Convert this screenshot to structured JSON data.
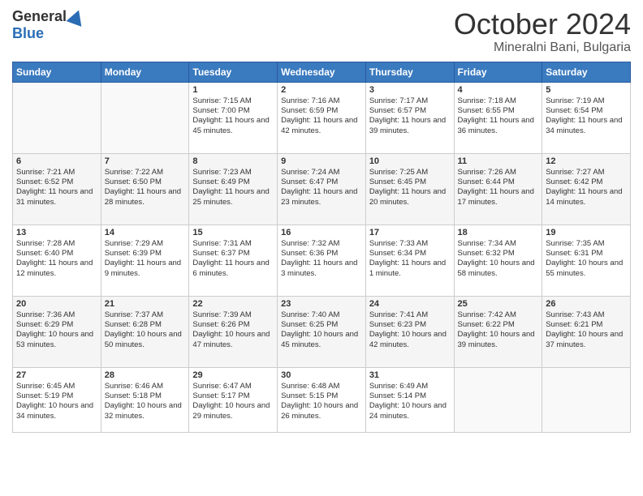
{
  "logo": {
    "general": "General",
    "blue": "Blue"
  },
  "title": "October 2024",
  "location": "Mineralni Bani, Bulgaria",
  "days_header": [
    "Sunday",
    "Monday",
    "Tuesday",
    "Wednesday",
    "Thursday",
    "Friday",
    "Saturday"
  ],
  "weeks": [
    [
      {
        "num": "",
        "text": ""
      },
      {
        "num": "",
        "text": ""
      },
      {
        "num": "1",
        "text": "Sunrise: 7:15 AM\nSunset: 7:00 PM\nDaylight: 11 hours and 45 minutes."
      },
      {
        "num": "2",
        "text": "Sunrise: 7:16 AM\nSunset: 6:59 PM\nDaylight: 11 hours and 42 minutes."
      },
      {
        "num": "3",
        "text": "Sunrise: 7:17 AM\nSunset: 6:57 PM\nDaylight: 11 hours and 39 minutes."
      },
      {
        "num": "4",
        "text": "Sunrise: 7:18 AM\nSunset: 6:55 PM\nDaylight: 11 hours and 36 minutes."
      },
      {
        "num": "5",
        "text": "Sunrise: 7:19 AM\nSunset: 6:54 PM\nDaylight: 11 hours and 34 minutes."
      }
    ],
    [
      {
        "num": "6",
        "text": "Sunrise: 7:21 AM\nSunset: 6:52 PM\nDaylight: 11 hours and 31 minutes."
      },
      {
        "num": "7",
        "text": "Sunrise: 7:22 AM\nSunset: 6:50 PM\nDaylight: 11 hours and 28 minutes."
      },
      {
        "num": "8",
        "text": "Sunrise: 7:23 AM\nSunset: 6:49 PM\nDaylight: 11 hours and 25 minutes."
      },
      {
        "num": "9",
        "text": "Sunrise: 7:24 AM\nSunset: 6:47 PM\nDaylight: 11 hours and 23 minutes."
      },
      {
        "num": "10",
        "text": "Sunrise: 7:25 AM\nSunset: 6:45 PM\nDaylight: 11 hours and 20 minutes."
      },
      {
        "num": "11",
        "text": "Sunrise: 7:26 AM\nSunset: 6:44 PM\nDaylight: 11 hours and 17 minutes."
      },
      {
        "num": "12",
        "text": "Sunrise: 7:27 AM\nSunset: 6:42 PM\nDaylight: 11 hours and 14 minutes."
      }
    ],
    [
      {
        "num": "13",
        "text": "Sunrise: 7:28 AM\nSunset: 6:40 PM\nDaylight: 11 hours and 12 minutes."
      },
      {
        "num": "14",
        "text": "Sunrise: 7:29 AM\nSunset: 6:39 PM\nDaylight: 11 hours and 9 minutes."
      },
      {
        "num": "15",
        "text": "Sunrise: 7:31 AM\nSunset: 6:37 PM\nDaylight: 11 hours and 6 minutes."
      },
      {
        "num": "16",
        "text": "Sunrise: 7:32 AM\nSunset: 6:36 PM\nDaylight: 11 hours and 3 minutes."
      },
      {
        "num": "17",
        "text": "Sunrise: 7:33 AM\nSunset: 6:34 PM\nDaylight: 11 hours and 1 minute."
      },
      {
        "num": "18",
        "text": "Sunrise: 7:34 AM\nSunset: 6:32 PM\nDaylight: 10 hours and 58 minutes."
      },
      {
        "num": "19",
        "text": "Sunrise: 7:35 AM\nSunset: 6:31 PM\nDaylight: 10 hours and 55 minutes."
      }
    ],
    [
      {
        "num": "20",
        "text": "Sunrise: 7:36 AM\nSunset: 6:29 PM\nDaylight: 10 hours and 53 minutes."
      },
      {
        "num": "21",
        "text": "Sunrise: 7:37 AM\nSunset: 6:28 PM\nDaylight: 10 hours and 50 minutes."
      },
      {
        "num": "22",
        "text": "Sunrise: 7:39 AM\nSunset: 6:26 PM\nDaylight: 10 hours and 47 minutes."
      },
      {
        "num": "23",
        "text": "Sunrise: 7:40 AM\nSunset: 6:25 PM\nDaylight: 10 hours and 45 minutes."
      },
      {
        "num": "24",
        "text": "Sunrise: 7:41 AM\nSunset: 6:23 PM\nDaylight: 10 hours and 42 minutes."
      },
      {
        "num": "25",
        "text": "Sunrise: 7:42 AM\nSunset: 6:22 PM\nDaylight: 10 hours and 39 minutes."
      },
      {
        "num": "26",
        "text": "Sunrise: 7:43 AM\nSunset: 6:21 PM\nDaylight: 10 hours and 37 minutes."
      }
    ],
    [
      {
        "num": "27",
        "text": "Sunrise: 6:45 AM\nSunset: 5:19 PM\nDaylight: 10 hours and 34 minutes."
      },
      {
        "num": "28",
        "text": "Sunrise: 6:46 AM\nSunset: 5:18 PM\nDaylight: 10 hours and 32 minutes."
      },
      {
        "num": "29",
        "text": "Sunrise: 6:47 AM\nSunset: 5:17 PM\nDaylight: 10 hours and 29 minutes."
      },
      {
        "num": "30",
        "text": "Sunrise: 6:48 AM\nSunset: 5:15 PM\nDaylight: 10 hours and 26 minutes."
      },
      {
        "num": "31",
        "text": "Sunrise: 6:49 AM\nSunset: 5:14 PM\nDaylight: 10 hours and 24 minutes."
      },
      {
        "num": "",
        "text": ""
      },
      {
        "num": "",
        "text": ""
      }
    ]
  ]
}
